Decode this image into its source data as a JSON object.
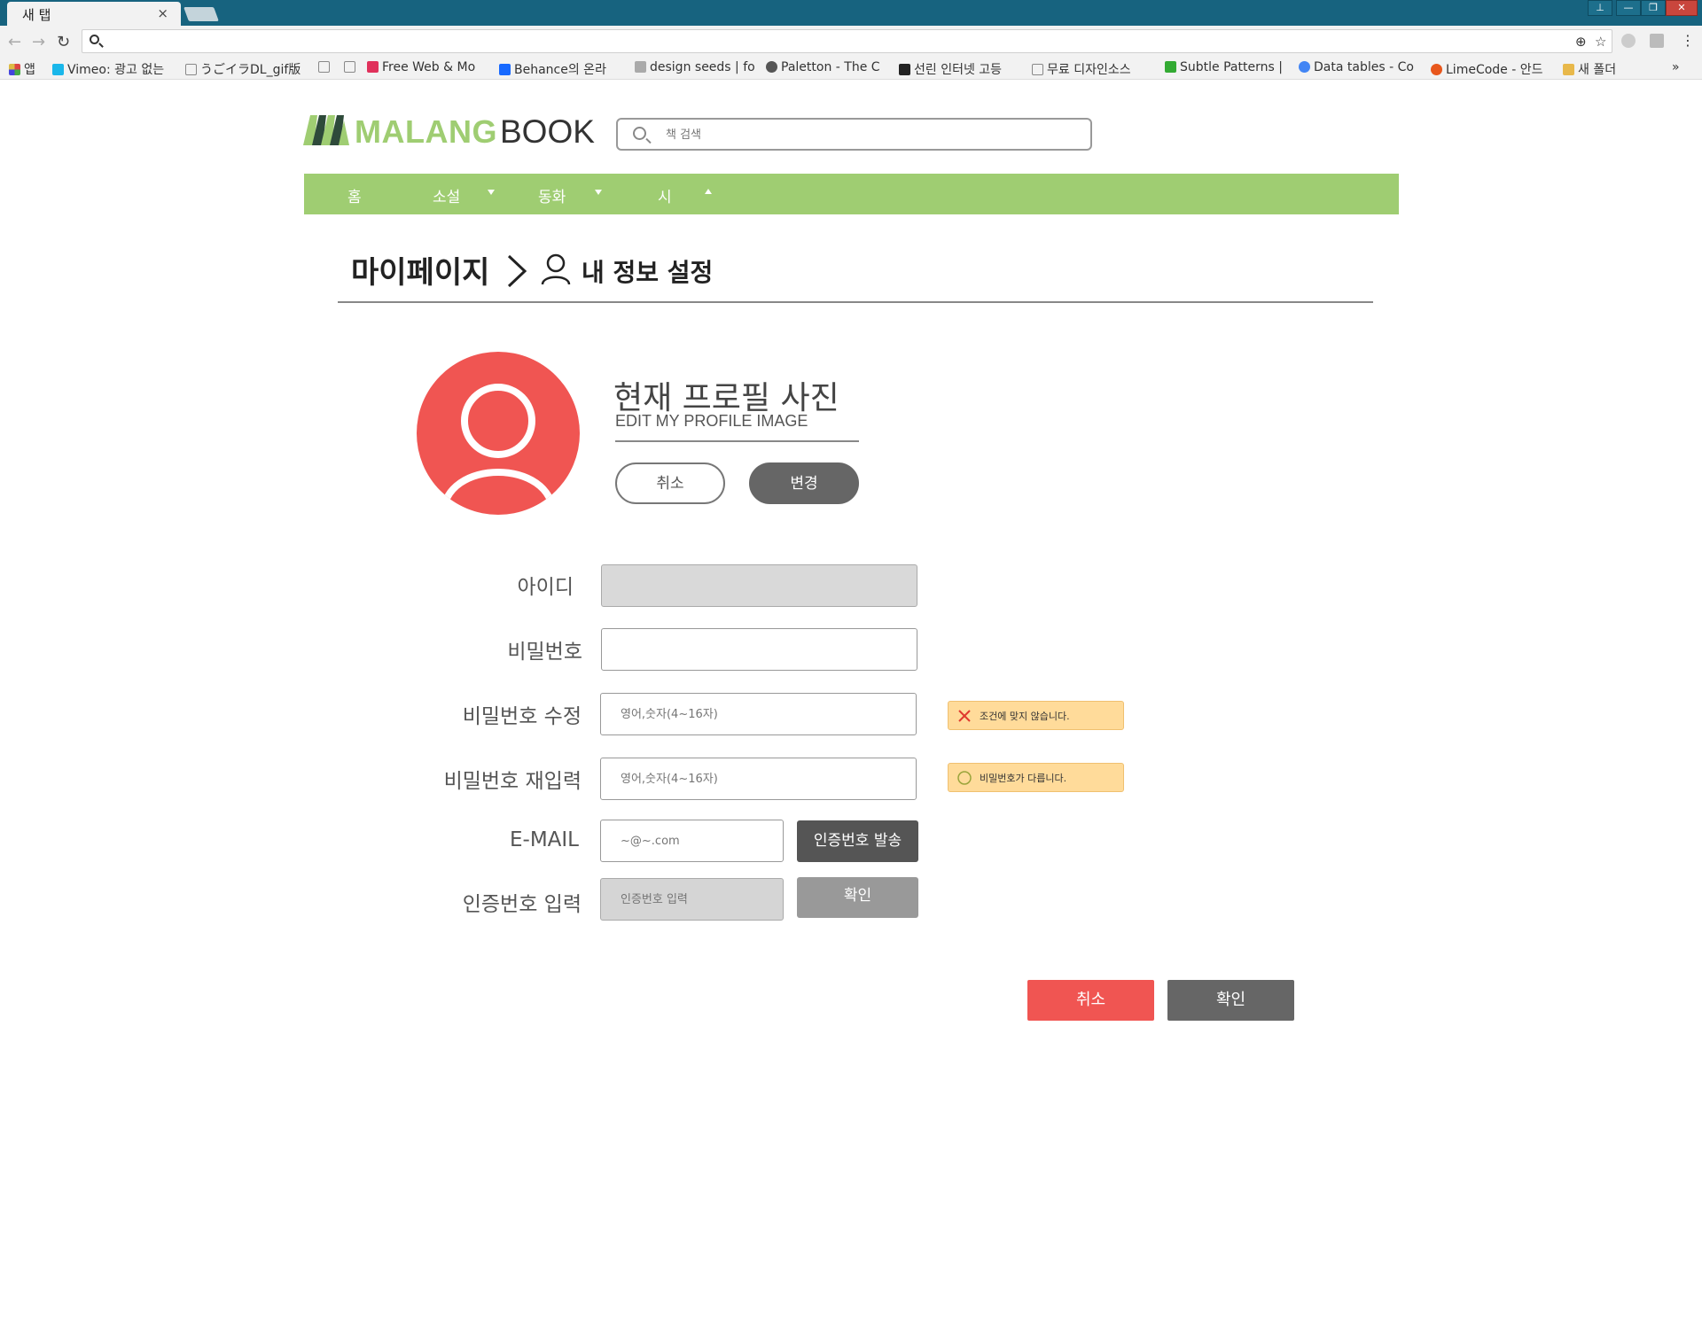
{
  "browser": {
    "tab_title": "새 탭",
    "tab_close": "×",
    "window_buttons": [
      "⊥",
      "—",
      "❐",
      "✕"
    ],
    "bookmarks": [
      {
        "label": "앱",
        "icon": "apps-grid-icon",
        "color": "#d44"
      },
      {
        "label": "Vimeo: 광고 없는",
        "icon": "vimeo-icon",
        "color": "#1ab7ea"
      },
      {
        "label": "うごイラDL_gif版",
        "icon": "page-icon",
        "color": "#888"
      },
      {
        "label": "",
        "icon": "page-icon",
        "color": "#888"
      },
      {
        "label": "",
        "icon": "page-icon",
        "color": "#888"
      },
      {
        "label": "Free Web & Mo",
        "icon": "invision-icon",
        "color": "#e0315b"
      },
      {
        "label": "Behance의 온라",
        "icon": "behance-icon",
        "color": "#1769ff"
      },
      {
        "label": "design seeds | fo",
        "icon": "design-seeds-icon",
        "color": "#999"
      },
      {
        "label": "Paletton - The C",
        "icon": "paletton-icon",
        "color": "#555"
      },
      {
        "label": "선린 인터넷 고등",
        "icon": "sunrin-icon",
        "color": "#222"
      },
      {
        "label": "무료 디자인소스",
        "icon": "page-icon",
        "color": "#888"
      },
      {
        "label": "Subtle Patterns |",
        "icon": "subtle-patterns-icon",
        "color": "#3a3"
      },
      {
        "label": "Data tables - Co",
        "icon": "google-icon",
        "color": "#4285f4"
      },
      {
        "label": "LimeCode - 안드",
        "icon": "limecode-icon",
        "color": "#e8571c"
      },
      {
        "label": "새 폴더",
        "icon": "folder-icon",
        "color": "#e8b84a"
      }
    ],
    "overflow": "»"
  },
  "site": {
    "logo_primary": "MALANG",
    "logo_secondary": "BOOK",
    "search_placeholder": "책 검색",
    "nav": [
      {
        "label": "홈",
        "caret": ""
      },
      {
        "label": "소설",
        "caret": "down"
      },
      {
        "label": "동화",
        "caret": "down"
      },
      {
        "label": "시",
        "caret": "up"
      }
    ],
    "colors": {
      "brand_green": "#9fcd72",
      "accent_red": "#f05552",
      "warn_yellow": "#ffdb9a"
    }
  },
  "breadcrumb": {
    "root": "마이페이지",
    "current": "내 정보 설정"
  },
  "profile": {
    "title": "현재 프로필 사진",
    "subtitle": "EDIT MY PROFILE IMAGE",
    "cancel_label": "취소",
    "change_label": "변경"
  },
  "form": {
    "id_label": "아이디",
    "password_label": "비밀번호",
    "new_password_label": "비밀번호 수정",
    "new_password_placeholder": "영어,숫자(4~16자)",
    "new_password_warning": "조건에 맞지 않습니다.",
    "confirm_password_label": "비밀번호 재입력",
    "confirm_password_placeholder": "영어,숫자(4~16자)",
    "confirm_password_warning": "비밀번호가 다릅니다.",
    "email_label": "E-MAIL",
    "email_placeholder": "~@~.com",
    "send_code_label": "인증번호 발송",
    "code_label": "인증번호 입력",
    "code_placeholder": "인증번호 입력",
    "verify_label": "확인"
  },
  "footer_actions": {
    "cancel_label": "취소",
    "confirm_label": "확인"
  }
}
